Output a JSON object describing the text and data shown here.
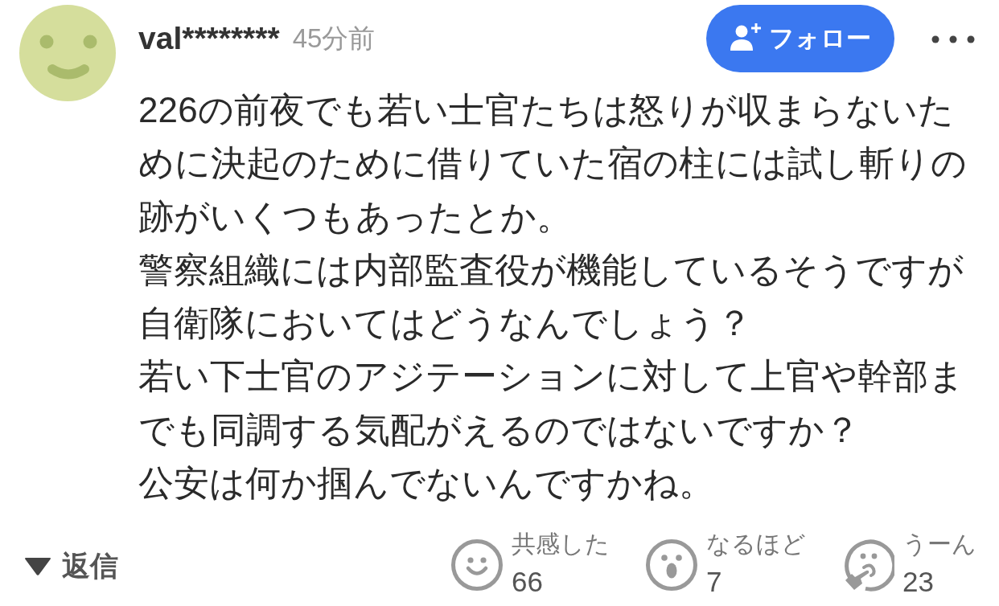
{
  "comment": {
    "author": {
      "name": "val********",
      "time": "45分前"
    },
    "follow_button": {
      "label": "フォロー"
    },
    "body_lines": [
      "226の前夜でも若い士官たちは怒りが収まらないた",
      "めに決起のために借りていた宿の柱には試し斬りの",
      "跡がいくつもあったとか。",
      "警察組織には内部監査役が機能しているそうですが",
      "自衛隊においてはどうなんでしょう？",
      "若い下士官のアジテーションに対して上官や幹部ま",
      "でも同調する気配がえるのではないですか？",
      "公安は何か掴んでないんですかね。"
    ],
    "reply_toggle": {
      "label": "返信"
    },
    "reactions": [
      {
        "kind": "smile",
        "label": "共感した",
        "count": "66"
      },
      {
        "kind": "surprised",
        "label": "なるほど",
        "count": "7"
      },
      {
        "kind": "thinking",
        "label": "うーん",
        "count": "23"
      }
    ]
  }
}
